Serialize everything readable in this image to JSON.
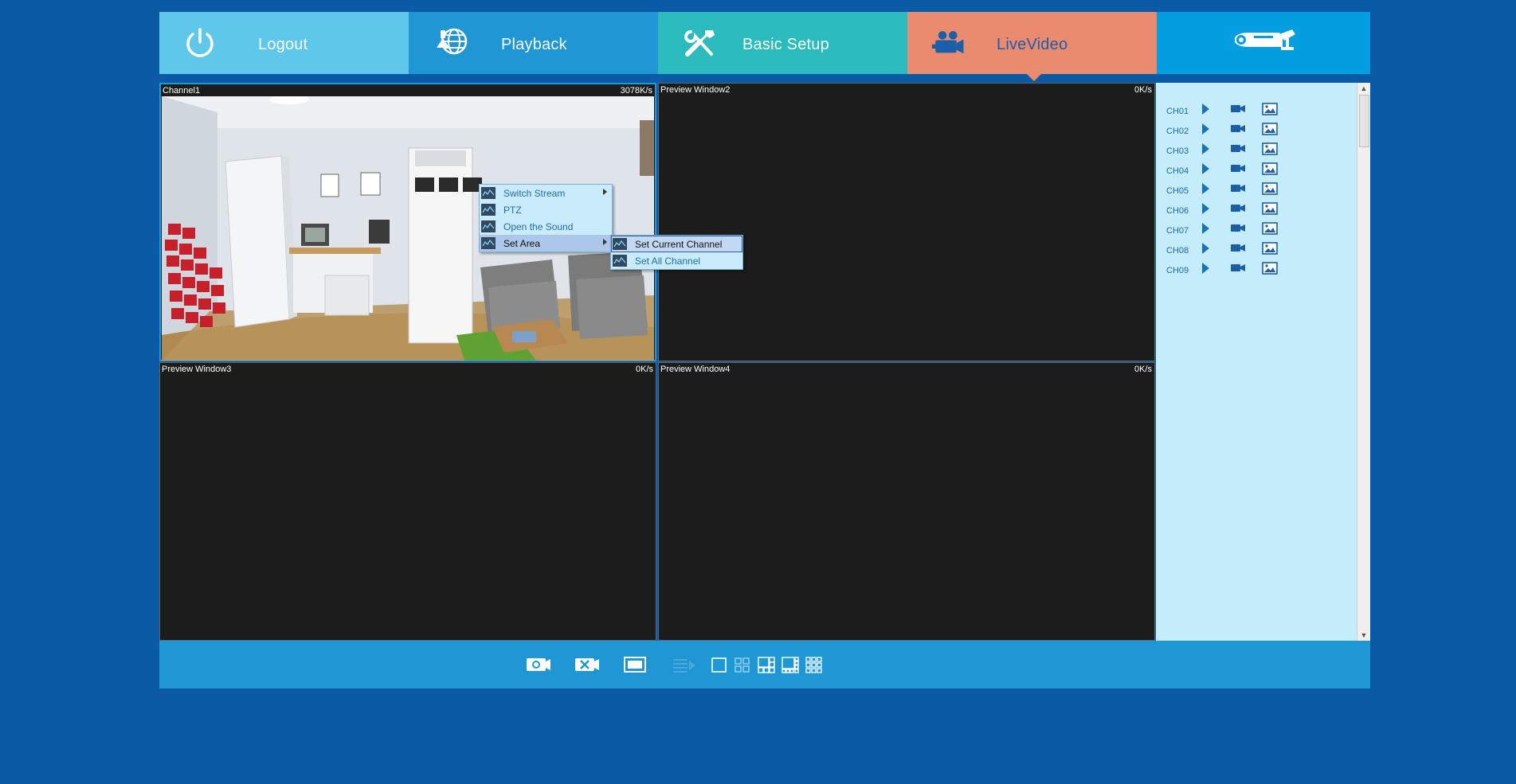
{
  "nav": {
    "logout": "Logout",
    "playback": "Playback",
    "basic_setup": "Basic Setup",
    "live_video": "LiveVideo"
  },
  "windows": [
    {
      "title": "Channel1",
      "rate": "3078K/s"
    },
    {
      "title": "Preview Window2",
      "rate": "0K/s"
    },
    {
      "title": "Preview Window3",
      "rate": "0K/s"
    },
    {
      "title": "Preview Window4",
      "rate": "0K/s"
    }
  ],
  "context_menu": {
    "items": [
      "Switch Stream",
      "PTZ",
      "Open the Sound",
      "Set Area"
    ],
    "submenu": [
      "Set Current Channel",
      "Set All Channel"
    ]
  },
  "channels": [
    "CH01",
    "CH02",
    "CH03",
    "CH04",
    "CH05",
    "CH06",
    "CH07",
    "CH08",
    "CH09"
  ],
  "icons": {
    "logout": "power-icon",
    "playback": "globe-download-icon",
    "basic_setup": "tools-icon",
    "live_video": "video-camera-icon",
    "brand": "cctv-camera-icon"
  },
  "colors": {
    "background": "#0b5aa6",
    "logout_tab": "#5fc8ea",
    "playback_tab": "#1e97d4",
    "basic_setup_tab": "#2bbbbd",
    "live_tab": "#ea8b70",
    "panel": "#c5ecfb"
  }
}
